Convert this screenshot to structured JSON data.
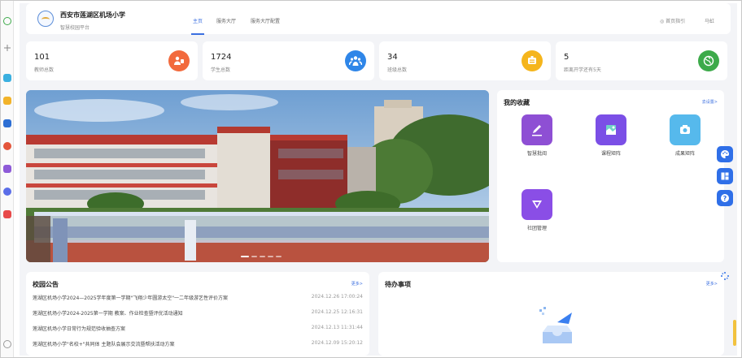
{
  "header": {
    "school_name": "西安市莲湖区机场小学",
    "platform": "智慧校园平台",
    "nav": [
      "主页",
      "服务大厅",
      "服务大厅配置"
    ],
    "guide": "◎ 首页指引",
    "user": "马虹"
  },
  "stats": [
    {
      "value": "101",
      "label": "教师总数",
      "icon": "teacher-icon",
      "color": "#f26a3d"
    },
    {
      "value": "1724",
      "label": "学生总数",
      "icon": "students-icon",
      "color": "#2f86e8"
    },
    {
      "value": "34",
      "label": "班级总数",
      "icon": "class-icon",
      "color": "#f5b51c"
    },
    {
      "value": "5",
      "label": "距离开学还有5天",
      "icon": "globe-icon",
      "color": "#3daa4a"
    }
  ],
  "favorites": {
    "title": "我的收藏",
    "more": "去设置>",
    "items": [
      {
        "label": "智慧批阅",
        "icon": "edit-icon",
        "color": "#8e4fd4"
      },
      {
        "label": "课程矩阵",
        "icon": "map-icon",
        "color": "#7b4fe6"
      },
      {
        "label": "成果矩阵",
        "icon": "camera-icon",
        "color": "#56b9ec"
      },
      {
        "label": "社团管理",
        "icon": "flag-icon",
        "color": "#8a4ee6"
      }
    ]
  },
  "notice": {
    "title": "校园公告",
    "more": "更多>",
    "items": [
      {
        "title": "莲湖区机场小学2024—2025学年度第一学期\"飞翔少年圆游太空\"一二年级游艺性评价方案",
        "date": "2024.12.26 17:00:24"
      },
      {
        "title": "莲湖区机场小学2024-2025第一学期 教案、作业检查暨评优活动通知",
        "date": "2024.12.25 12:16:31"
      },
      {
        "title": "莲湖区机场小学日常行为规范验收抽查方案",
        "date": "2024.12.13 11:31:44"
      },
      {
        "title": "莲湖区机场小学\"名校+\"共同体 主题队会展示交流暨帮扶活动方案",
        "date": "2024.12.09 15:20:12"
      }
    ]
  },
  "todo": {
    "title": "待办事项",
    "more": "更多>"
  },
  "side_buttons": [
    "palette-icon",
    "layout-icon",
    "help-icon"
  ],
  "banner_slides": 5,
  "banner_active": 0
}
